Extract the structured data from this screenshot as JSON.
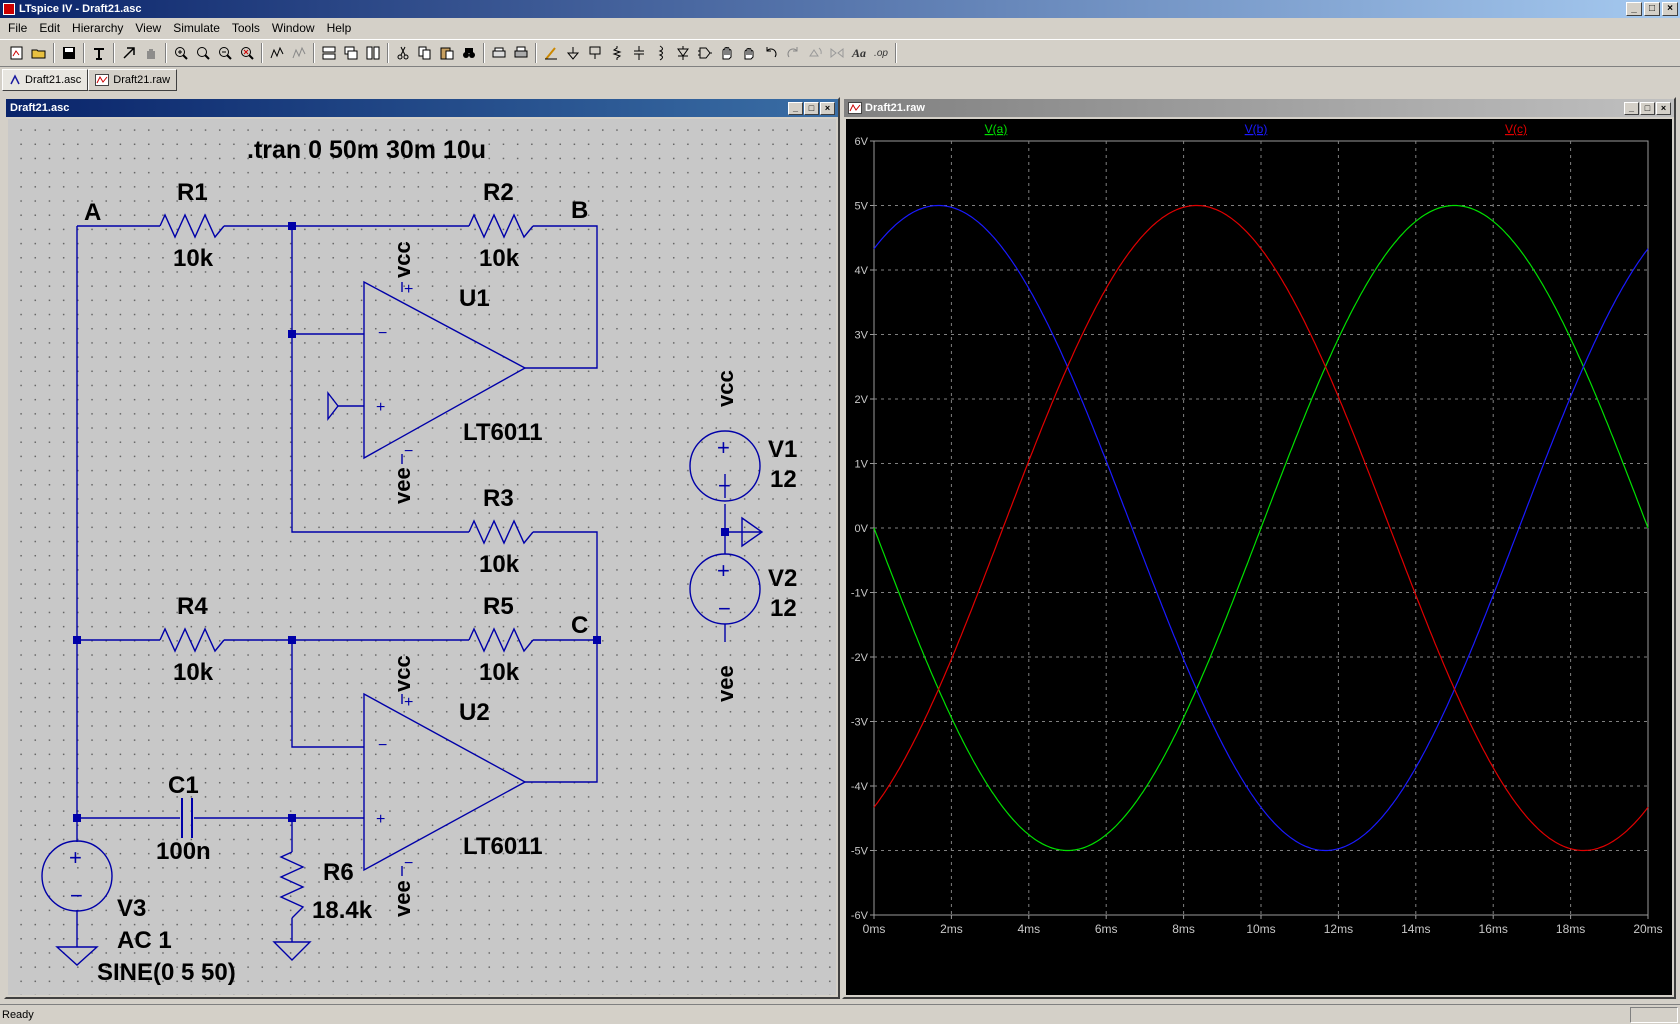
{
  "app": {
    "title": "LTspice IV - Draft21.asc",
    "status": "Ready"
  },
  "menu": [
    "File",
    "Edit",
    "Hierarchy",
    "View",
    "Simulate",
    "Tools",
    "Window",
    "Help"
  ],
  "toolbar": {
    "icons": [
      "new-schematic-icon",
      "open-icon",
      "save-icon",
      "control-panel-icon",
      "run-icon",
      "halt-icon",
      "zoom-in-icon",
      "zoom-pan-icon",
      "zoom-out-icon",
      "zoom-fit-icon",
      "autorange-icon",
      "autorange-y-icon",
      "tile-horizontal-icon",
      "cascade-icon",
      "tile-vertical-icon",
      "cut-icon",
      "copy-icon",
      "paste-icon",
      "find-icon",
      "print-setup-icon",
      "print-icon",
      "draw-wire-icon",
      "ground-icon",
      "label-net-icon",
      "resistor-icon",
      "capacitor-icon",
      "inductor-icon",
      "diode-icon",
      "component-icon",
      "move-icon",
      "drag-icon",
      "undo-icon",
      "redo-icon",
      "rotate-icon",
      "mirror-icon",
      "text-icon",
      "spice-directive-icon"
    ],
    "text_icon_label": "Aa",
    "op_icon_label": ".op"
  },
  "tabs": [
    {
      "label": "Draft21.asc",
      "active": true,
      "icon": "schematic-icon"
    },
    {
      "label": "Draft21.raw",
      "active": false,
      "icon": "waveform-icon"
    }
  ],
  "schematic_window": {
    "title": "Draft21.asc",
    "directive": ".tran 0 50m 30m 10u",
    "nodes": {
      "a": "A",
      "b": "B",
      "c": "C"
    },
    "components": {
      "r1": {
        "name": "R1",
        "value": "10k"
      },
      "r2": {
        "name": "R2",
        "value": "10k"
      },
      "r3": {
        "name": "R3",
        "value": "10k"
      },
      "r4": {
        "name": "R4",
        "value": "10k"
      },
      "r5": {
        "name": "R5",
        "value": "10k"
      },
      "r6": {
        "name": "R6",
        "value": "18.4k"
      },
      "c1": {
        "name": "C1",
        "value": "100n"
      },
      "u1": {
        "name": "U1",
        "model": "LT6011"
      },
      "u2": {
        "name": "U2",
        "model": "LT6011"
      },
      "v1": {
        "name": "V1",
        "value": "12"
      },
      "v2": {
        "name": "V2",
        "value": "12"
      },
      "v3": {
        "name": "V3",
        "line1": "AC 1",
        "line2": "SINE(0 5 50)"
      }
    },
    "net_labels": {
      "vcc": "vcc",
      "vee": "vee"
    },
    "pin_signs": {
      "plus": "+",
      "minus": "−"
    }
  },
  "waveform_window": {
    "title": "Draft21.raw"
  },
  "chart_data": {
    "type": "line",
    "title": "",
    "xlabel": "",
    "ylabel": "",
    "xlim": [
      0,
      20
    ],
    "ylim": [
      -6,
      6
    ],
    "x_unit": "ms",
    "y_unit": "V",
    "x_ticks": [
      "0ms",
      "2ms",
      "4ms",
      "6ms",
      "8ms",
      "10ms",
      "12ms",
      "14ms",
      "16ms",
      "18ms",
      "20ms"
    ],
    "y_ticks": [
      "6V",
      "5V",
      "4V",
      "3V",
      "2V",
      "1V",
      "0V",
      "-1V",
      "-2V",
      "-3V",
      "-4V",
      "-5V",
      "-6V"
    ],
    "grid": true,
    "legend": "top",
    "series": [
      {
        "name": "V(a)",
        "color": "#00e000",
        "amplitude": 5,
        "frequency_hz": 50,
        "phase_deg": 180,
        "x": [
          0,
          2,
          4,
          5,
          6,
          8,
          10,
          12,
          14,
          15,
          16,
          18,
          20
        ],
        "y": [
          0,
          -2.94,
          -4.76,
          -5,
          -4.76,
          -2.94,
          0,
          2.94,
          4.76,
          5,
          4.76,
          2.94,
          0
        ]
      },
      {
        "name": "V(b)",
        "color": "#1a1aff",
        "amplitude": 5,
        "frequency_hz": 50,
        "phase_deg": 60,
        "x": [
          0,
          1.67,
          2,
          4,
          6,
          8,
          10,
          11.67,
          12,
          14,
          16,
          18,
          20
        ],
        "y": [
          4.33,
          5,
          4.97,
          3.66,
          1.04,
          -2.08,
          -4.33,
          -5,
          -4.97,
          -3.66,
          -1.04,
          2.08,
          4.33
        ]
      },
      {
        "name": "V(c)",
        "color": "#e00000",
        "amplitude": 5,
        "frequency_hz": 50,
        "phase_deg": -60,
        "x": [
          0,
          2,
          4,
          6,
          8,
          8.33,
          10,
          12,
          14,
          16,
          18,
          18.33,
          20
        ],
        "y": [
          -4.33,
          -2.44,
          0.52,
          3.35,
          4.94,
          5,
          4.33,
          2.44,
          -0.52,
          -3.35,
          -4.94,
          -5,
          -4.33
        ]
      }
    ]
  }
}
